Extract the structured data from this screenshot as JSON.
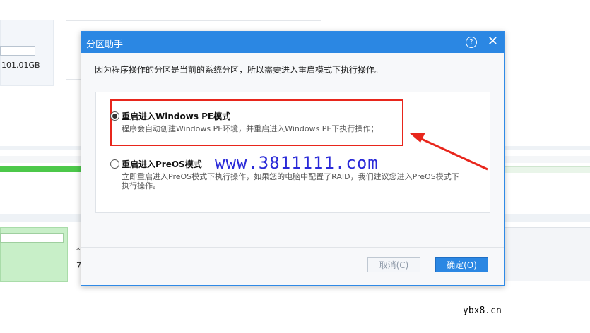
{
  "background": {
    "partition_size": "101.01GB",
    "fragment_chars": [
      "*",
      "7"
    ]
  },
  "dialog": {
    "title": "分区助手",
    "help_icon": "help-icon",
    "close_icon": "close-icon",
    "message": "因为程序操作的分区是当前的系统分区，所以需要进入重启模式下执行操作。",
    "options": [
      {
        "title": "重启进入Windows PE模式",
        "description": "程序会自动创建Windows PE环境，并重启进入Windows PE下执行操作；",
        "selected": true
      },
      {
        "title": "重启进入PreOS模式",
        "description": "立即重启进入PreOS模式下执行操作，如果您的电脑中配置了RAID，我们建议您进入PreOS模式下执行操作。",
        "selected": false
      }
    ],
    "cancel_label": "取消(C)",
    "ok_label": "确定(O)"
  },
  "annotation": {
    "watermark": "www.3811111.com",
    "highlight_color": "#e8261c",
    "arrow_color": "#e8261c"
  },
  "footer": {
    "site": "ybx8.cn"
  },
  "colors": {
    "accent": "#2b87e3",
    "progress_green": "#4cc84a"
  }
}
